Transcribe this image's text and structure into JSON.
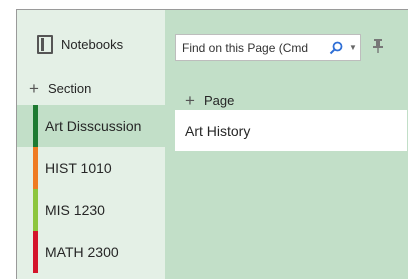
{
  "notebooks_button": {
    "label": "Notebooks",
    "icon": "notebook-icon"
  },
  "add_section": {
    "label": "Section",
    "icon": "plus-icon"
  },
  "sections": [
    {
      "label": "Art Disscussion",
      "color": "#1e7a32",
      "active": true
    },
    {
      "label": "HIST 1010",
      "color": "#ef7b22",
      "active": false
    },
    {
      "label": "MIS 1230",
      "color": "#8cc63e",
      "active": false
    },
    {
      "label": "MATH 2300",
      "color": "#d4142b",
      "active": false
    }
  ],
  "search": {
    "placeholder": "Find on this Page (Cmd",
    "icon": "search-icon",
    "dropdown_icon": "caret-down-icon"
  },
  "pin": {
    "icon": "pin-icon"
  },
  "add_page": {
    "label": "Page",
    "icon": "plus-icon"
  },
  "pages": [
    {
      "label": "Art History",
      "active": true
    }
  ],
  "colors": {
    "sections_pane": "#e4f0e6",
    "pages_pane": "#c2dfc8",
    "search_icon": "#2f6fd6"
  }
}
